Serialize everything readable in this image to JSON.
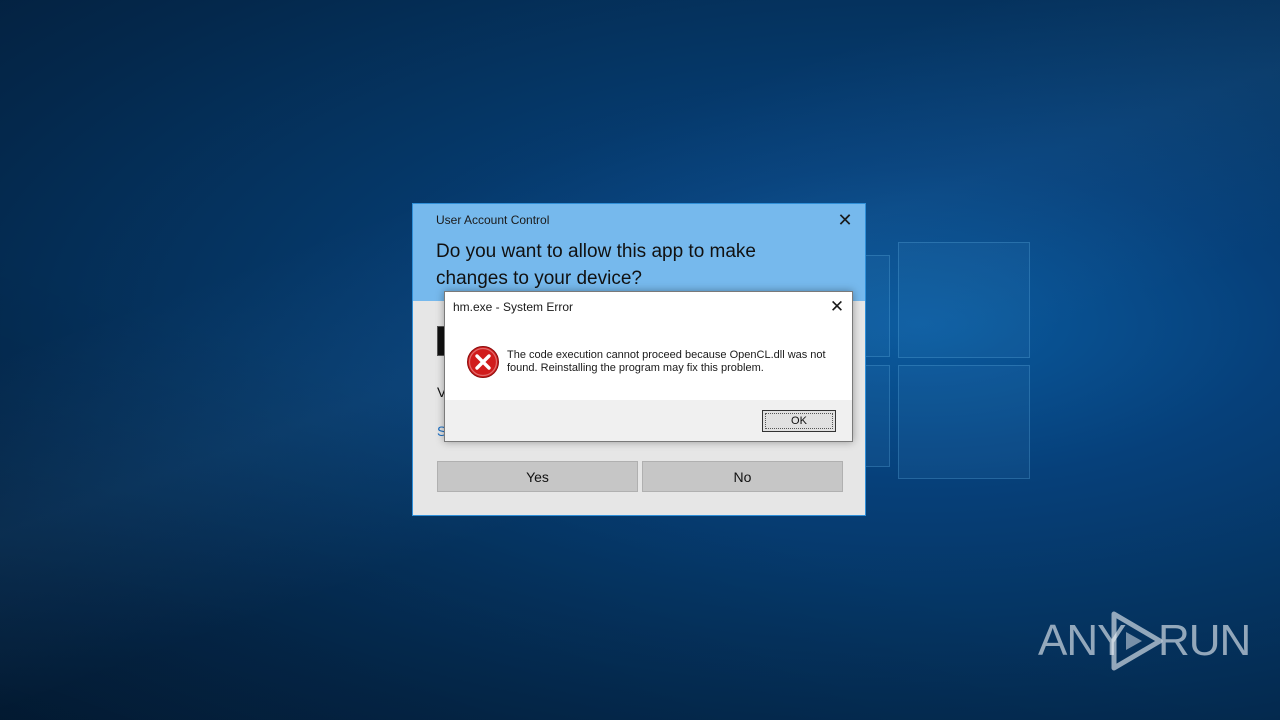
{
  "uac": {
    "title": "User Account Control",
    "close_glyph": "✕",
    "question": "Do you want to allow this app to make changes to your device?",
    "partial_text_v": "V",
    "partial_link_s": "S",
    "yes_label": "Yes",
    "no_label": "No"
  },
  "error_dialog": {
    "title": "hm.exe - System Error",
    "close_glyph": "✕",
    "message": "The code execution cannot proceed because OpenCL.dll was not found. Reinstalling the program may fix this problem.",
    "ok_label": "OK",
    "icon": "error-icon"
  },
  "watermark": {
    "left_text": "ANY",
    "right_text": "RUN",
    "icon": "play-icon"
  },
  "colors": {
    "uac_header": "#76b9ed",
    "uac_border": "#2f8fd8",
    "error_red": "#d11c1c",
    "link_blue": "#1b6fc4"
  }
}
